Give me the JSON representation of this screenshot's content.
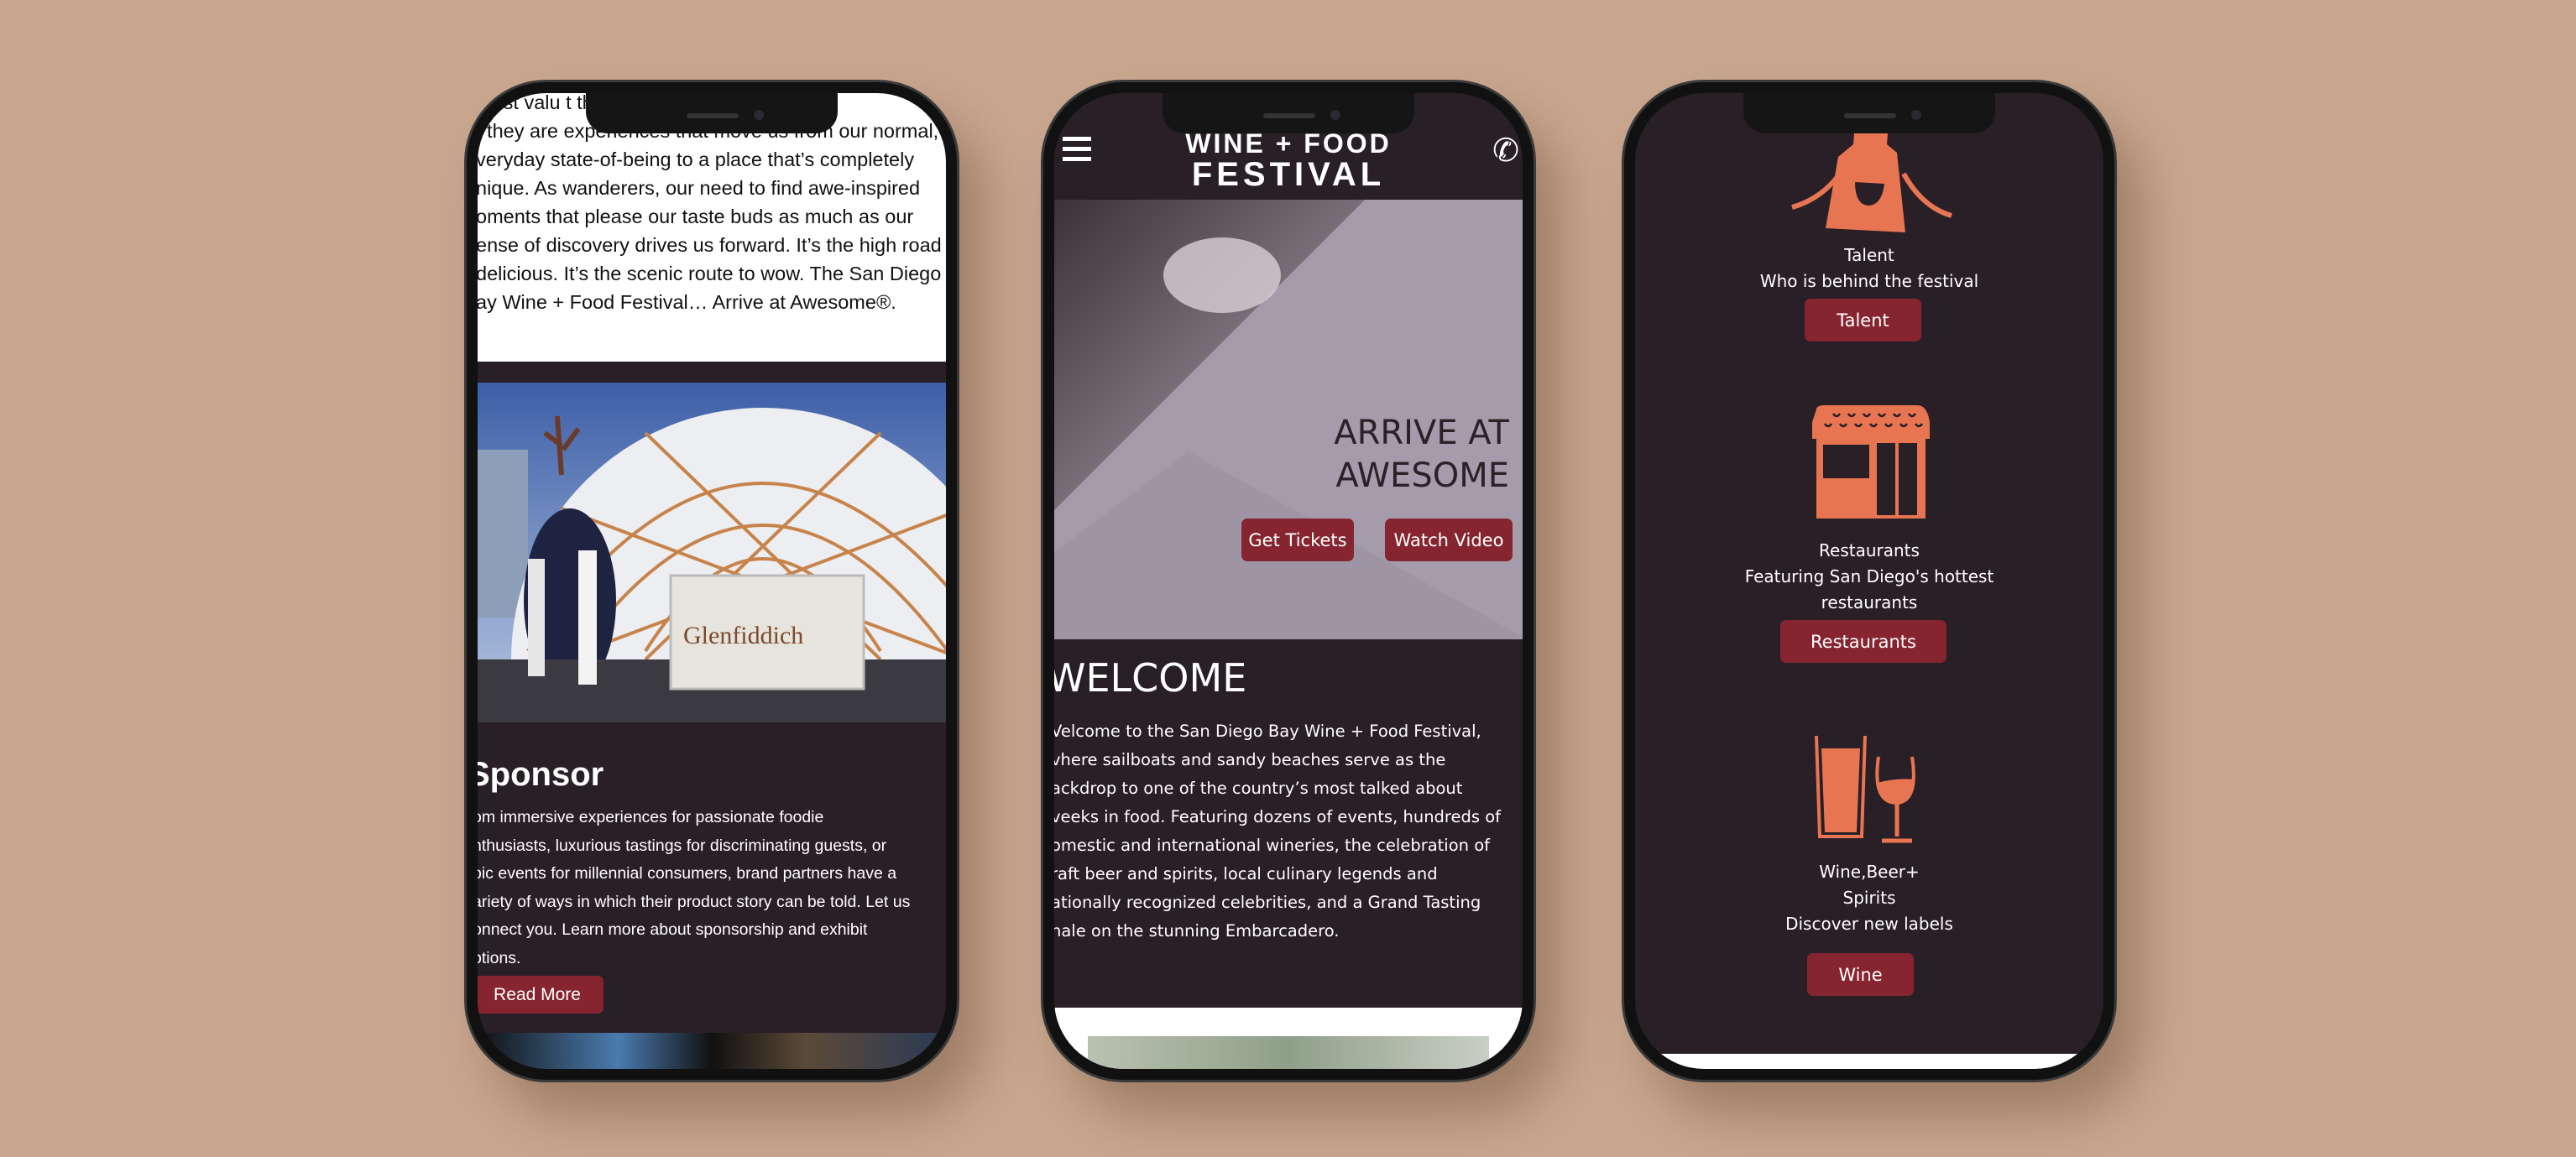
{
  "phone1": {
    "intro_lines": [
      "most valu                                    t things at",
      ", they are experiences that move us from our normal,",
      "veryday state-of-being to a place that’s completely",
      "nique. As wanderers, our need to find awe-inspired",
      "oments that please our taste buds as much as our",
      "ense of discovery drives us forward. It’s the high road",
      " delicious. It’s the scenic route to wow. The San Diego",
      "ay Wine + Food Festival… Arrive at Awesome®."
    ],
    "photo_brand": "Glenfiddich",
    "sponsor_heading": "Sponsor",
    "sponsor_lines": [
      "om immersive experiences for passionate foodie",
      "nthusiasts, luxurious tastings for discriminating guests, or",
      "pic events for millennial consumers, brand partners have a",
      "ariety of ways in which their product story can be told. Let us",
      "onnect you. Learn more about sponsorship and exhibit",
      "ptions."
    ],
    "read_more": "Read More"
  },
  "phone2": {
    "logo_line1": "WINE + FOOD",
    "logo_line2": "FESTIVAL",
    "menu_icon": "hamburger-icon",
    "phone_icon": "phone-icon",
    "hero_line1": "ARRIVE AT",
    "hero_line2": "AWESOME",
    "get_tickets": "Get Tickets",
    "watch_video": "Watch Video",
    "welcome_heading": "WELCOME",
    "welcome_lines": [
      "Velcome to the San Diego Bay Wine + Food Festival,",
      "vhere sailboats and sandy beaches serve as the",
      "ackdrop to one of the country’s most talked about",
      "veeks in food. Featuring dozens of events, hundreds of",
      "omestic and international wineries, the celebration of",
      "raft beer and spirits, local culinary legends and",
      "ationally recognized celebrities, and a Grand Tasting",
      "nale on the stunning Embarcadero."
    ]
  },
  "phone3": {
    "talent": {
      "title": "Talent",
      "subtitle": "Who is behind the festival",
      "button": "Talent",
      "icon": "apron-icon"
    },
    "restaurants": {
      "title": "Restaurants",
      "subtitle1": "Featuring San Diego's hottest",
      "subtitle2": "restaurants",
      "button": "Restaurants",
      "icon": "storefront-icon"
    },
    "wine": {
      "title1": "Wine,Beer+",
      "title2": "Spirits",
      "subtitle": "Discover new labels",
      "button": "Wine",
      "icon": "beer-wine-glasses-icon"
    }
  },
  "colors": {
    "background": "#c9a78f",
    "screen_dark": "#291f27",
    "button": "#862430",
    "icon_orange": "#e87552",
    "hero": "#a59cab"
  }
}
